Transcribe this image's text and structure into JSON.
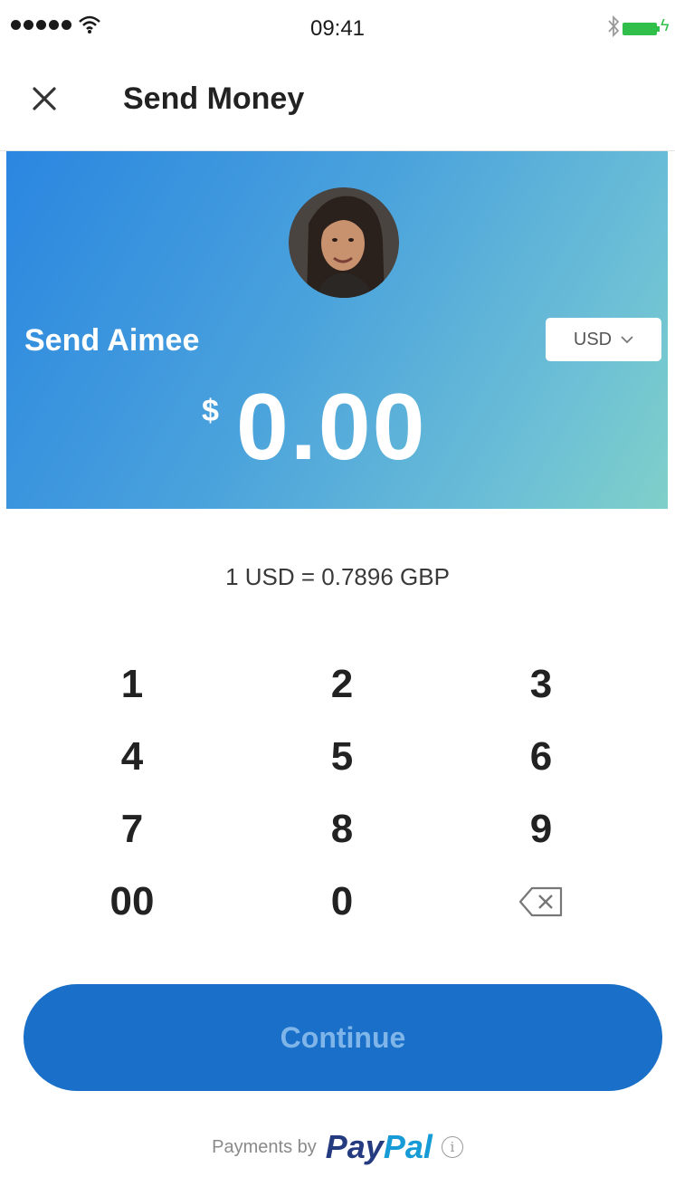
{
  "status_bar": {
    "time": "09:41"
  },
  "header": {
    "title": "Send Money",
    "close_icon": "close-icon"
  },
  "recipient": {
    "label": "Send Aimee",
    "avatar": "avatar-photo"
  },
  "currency": {
    "selected": "USD",
    "icon": "chevron-down-icon"
  },
  "amount": {
    "symbol": "$",
    "value": "0.00"
  },
  "exchange_rate": "1 USD = 0.7896 GBP",
  "keypad": {
    "keys": [
      "1",
      "2",
      "3",
      "4",
      "5",
      "6",
      "7",
      "8",
      "9",
      "00",
      "0"
    ],
    "backspace_icon": "backspace-icon"
  },
  "continue_label": "Continue",
  "footer": {
    "text": "Payments by",
    "brand_part1": "Pay",
    "brand_part2": "Pal",
    "info_icon": "info-icon"
  },
  "colors": {
    "primary_blue": "#1a70c8",
    "gradient_start": "#2a86e0",
    "gradient_end": "#7fd0c9"
  }
}
